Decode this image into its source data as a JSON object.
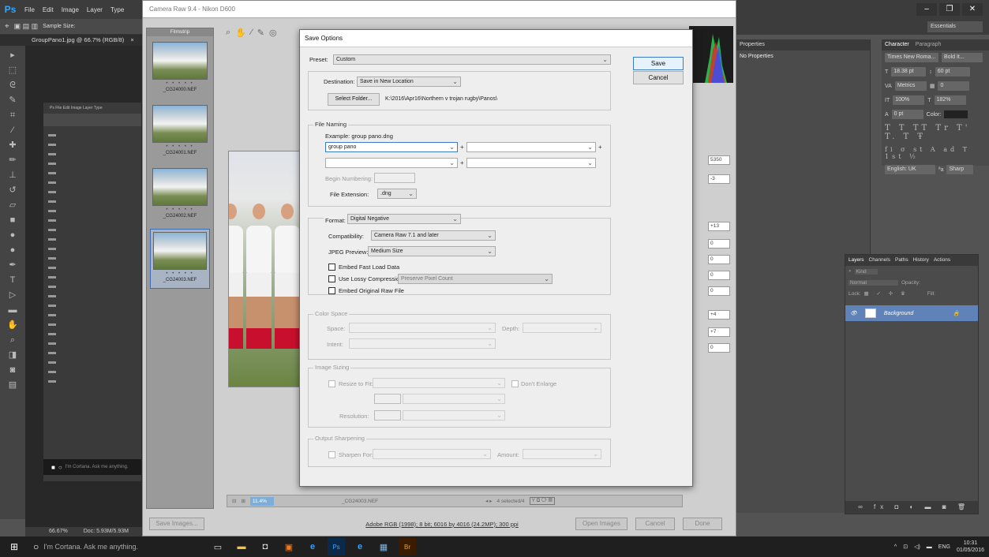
{
  "ps": {
    "logo": "Ps",
    "menus": [
      "File",
      "Edit",
      "Image",
      "Layer",
      "Type"
    ],
    "options_label": "Sample Size:",
    "doc_tab": "GroupPano1.jpg @ 66.7% (RGB/8)",
    "doc_tab_close": "×",
    "zoom": "66.67%",
    "doc_size": "Doc: 5.93M/5.93M",
    "workspace": "Essentials",
    "properties_tab": "Properties",
    "properties_body": "No Properties",
    "character_tab": "Character",
    "paragraph_tab": "Paragraph",
    "font_family": "Times New Roma...",
    "font_style": "Bold It...",
    "font_size": "18.38 pt",
    "leading": "60 pt",
    "kerning": "Metrics",
    "tracking": "0",
    "vscale": "100%",
    "hscale": "182%",
    "baseline": "0 pt",
    "color_label": "Color:",
    "language": "English: UK",
    "antialias": "Sharp",
    "layers_tabs": [
      "Layers",
      "Channels",
      "Paths",
      "History",
      "Actions"
    ],
    "layers_kind": "Kind",
    "layers_blend": "Normal",
    "layers_opacity": "Opacity:",
    "layers_lock": "Lock:",
    "layers_fill": "Fill:",
    "layer_name": "Background"
  },
  "cr": {
    "title": "Camera Raw 9.4 - Nikon D600",
    "filmstrip_label": "Filmstrip",
    "thumbs": [
      {
        "name": "_CG24000.NEF",
        "stars": "• • • • •"
      },
      {
        "name": "_CG24001.NEF",
        "stars": "• • • • •"
      },
      {
        "name": "_CG24002.NEF",
        "stars": "• • • • •"
      },
      {
        "name": "_CG24003.NEF",
        "stars": "• • • • •"
      }
    ],
    "zoom": "11.4%",
    "current_file": "_CG24003.NEF",
    "selected_count": "4 selected/4",
    "save_images": "Save Images...",
    "workflow": "Adobe RGB (1998); 8 bit; 6016 by 4016 (24.2MP); 300 ppi",
    "open_images": "Open Images",
    "cancel": "Cancel",
    "done": "Done",
    "slider_values": [
      "5350",
      "-3",
      "+13",
      "0",
      "0",
      "0",
      "0",
      "+4",
      "+7",
      "0"
    ]
  },
  "dialog": {
    "title": "Save Options",
    "preset_label": "Preset:",
    "preset_value": "Custom",
    "save_btn": "Save",
    "cancel_btn": "Cancel",
    "destination_label": "Destination:",
    "destination_value": "Save in New Location",
    "select_folder_btn": "Select Folder...",
    "folder_path": "K:\\2016\\Apr16\\Northern v trojan rugby\\Panos\\",
    "file_naming_title": "File Naming",
    "example": "Example:  group pano.dng",
    "name_field1": "group pano",
    "plus": "+",
    "begin_numbering": "Begin Numbering:",
    "file_ext_label": "File Extension:",
    "file_ext_value": ".dng",
    "format_label": "Format:",
    "format_value": "Digital Negative",
    "compat_label": "Compatibility:",
    "compat_value": "Camera Raw 7.1 and later",
    "jpeg_label": "JPEG Preview:",
    "jpeg_value": "Medium Size",
    "embed_fast": "Embed Fast Load Data",
    "lossy_label": "Use Lossy Compression:",
    "lossy_value": "Preserve Pixel Count",
    "embed_raw": "Embed Original Raw File",
    "color_space_title": "Color Space",
    "space_label": "Space:",
    "depth_label": "Depth:",
    "intent_label": "Intent:",
    "image_sizing_title": "Image Sizing",
    "resize_label": "Resize to Fit:",
    "dont_enlarge": "Don't Enlarge",
    "resolution_label": "Resolution:",
    "output_sharpening_title": "Output Sharpening",
    "sharpen_label": "Sharpen For:",
    "amount_label": "Amount:"
  },
  "inner": {
    "menus": "Ps  File  Edit  Image  Layer  Type",
    "cortana": "I'm Cortana. Ask me anything."
  },
  "taskbar": {
    "cortana": "I'm Cortana. Ask me anything.",
    "lang": "ENG",
    "time": "10:31",
    "date": "01/05/2016"
  },
  "colors": {
    "accent": "#3d7bc4",
    "ps_bg": "#535353",
    "selected_layer": "#5f82b8"
  }
}
